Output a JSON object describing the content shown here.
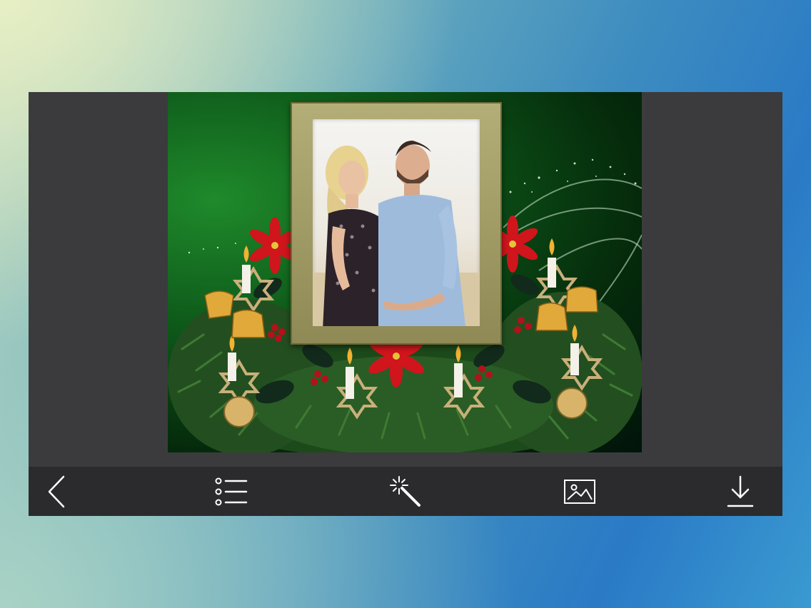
{
  "editor": {
    "canvas": {
      "frame_theme": "christmas-wreath-candles-poinsettia",
      "photo_subject": "couple"
    },
    "toolbar": {
      "items": [
        {
          "icon": "back-chevron-icon"
        },
        {
          "icon": "list-icon"
        },
        {
          "icon": "magic-wand-icon"
        },
        {
          "icon": "image-gallery-icon"
        },
        {
          "icon": "download-icon"
        }
      ]
    }
  },
  "colors": {
    "toolbar_bg": "#2b2b2d",
    "frame_bg": "#3b3b3d",
    "icon": "#ffffff"
  }
}
